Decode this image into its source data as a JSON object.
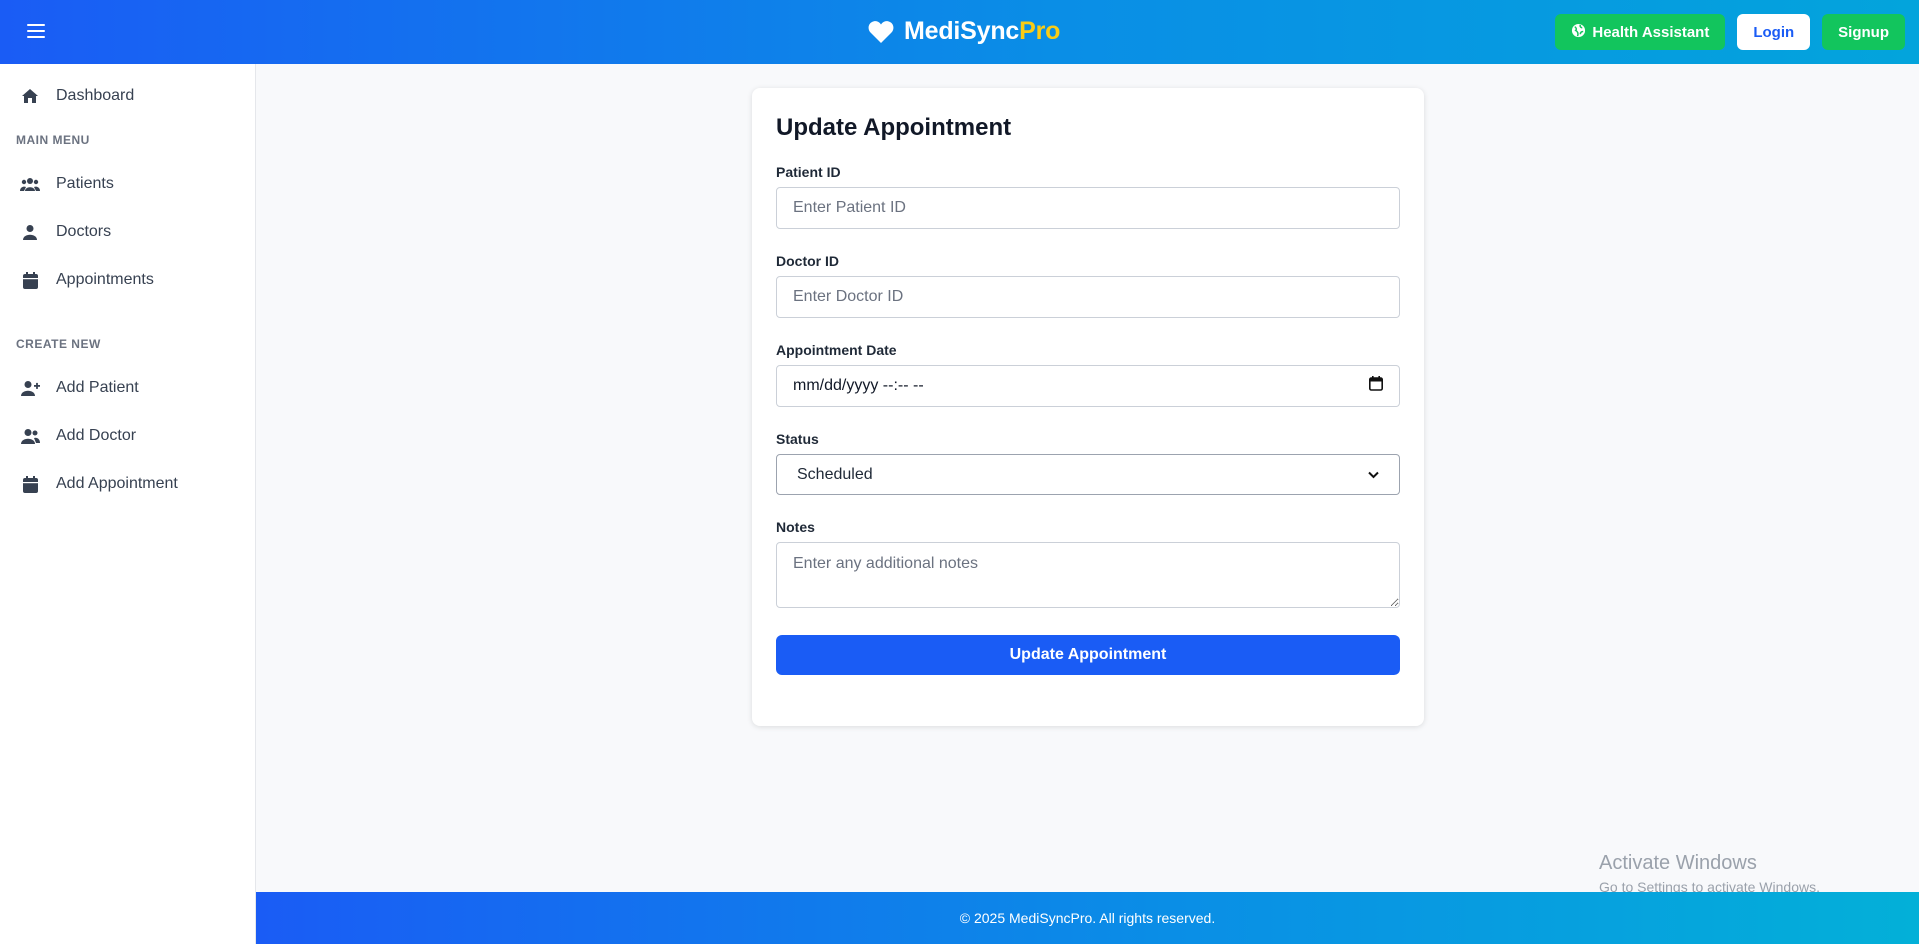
{
  "header": {
    "brand_main": "MediSync",
    "brand_accent": "Pro",
    "health_assistant_label": "Health Assistant",
    "login_label": "Login",
    "signup_label": "Signup"
  },
  "sidebar": {
    "dashboard": "Dashboard",
    "main_menu_title": "MAIN MENU",
    "main_items": [
      {
        "label": "Patients",
        "icon": "users-icon"
      },
      {
        "label": "Doctors",
        "icon": "user-icon"
      },
      {
        "label": "Appointments",
        "icon": "calendar-icon"
      }
    ],
    "create_new_title": "CREATE NEW",
    "create_items": [
      {
        "label": "Add Patient",
        "icon": "user-plus-icon"
      },
      {
        "label": "Add Doctor",
        "icon": "user-md-icon"
      },
      {
        "label": "Add Appointment",
        "icon": "calendar-plus-icon"
      }
    ]
  },
  "form": {
    "title": "Update Appointment",
    "patient_id_label": "Patient ID",
    "patient_id_placeholder": "Enter Patient ID",
    "doctor_id_label": "Doctor ID",
    "doctor_id_placeholder": "Enter Doctor ID",
    "date_label": "Appointment Date",
    "date_value": "mm/dd/yyyy --:-- --",
    "status_label": "Status",
    "status_value": "Scheduled",
    "notes_label": "Notes",
    "notes_placeholder": "Enter any additional notes",
    "submit_label": "Update Appointment"
  },
  "watermark": {
    "title": "Activate Windows",
    "subtitle": "Go to Settings to activate Windows."
  },
  "footer": {
    "text": "© 2025 MediSyncPro. All rights reserved."
  },
  "colors": {
    "primary": "#1a5cf5",
    "success": "#12c55d",
    "accent": "#facc15"
  }
}
